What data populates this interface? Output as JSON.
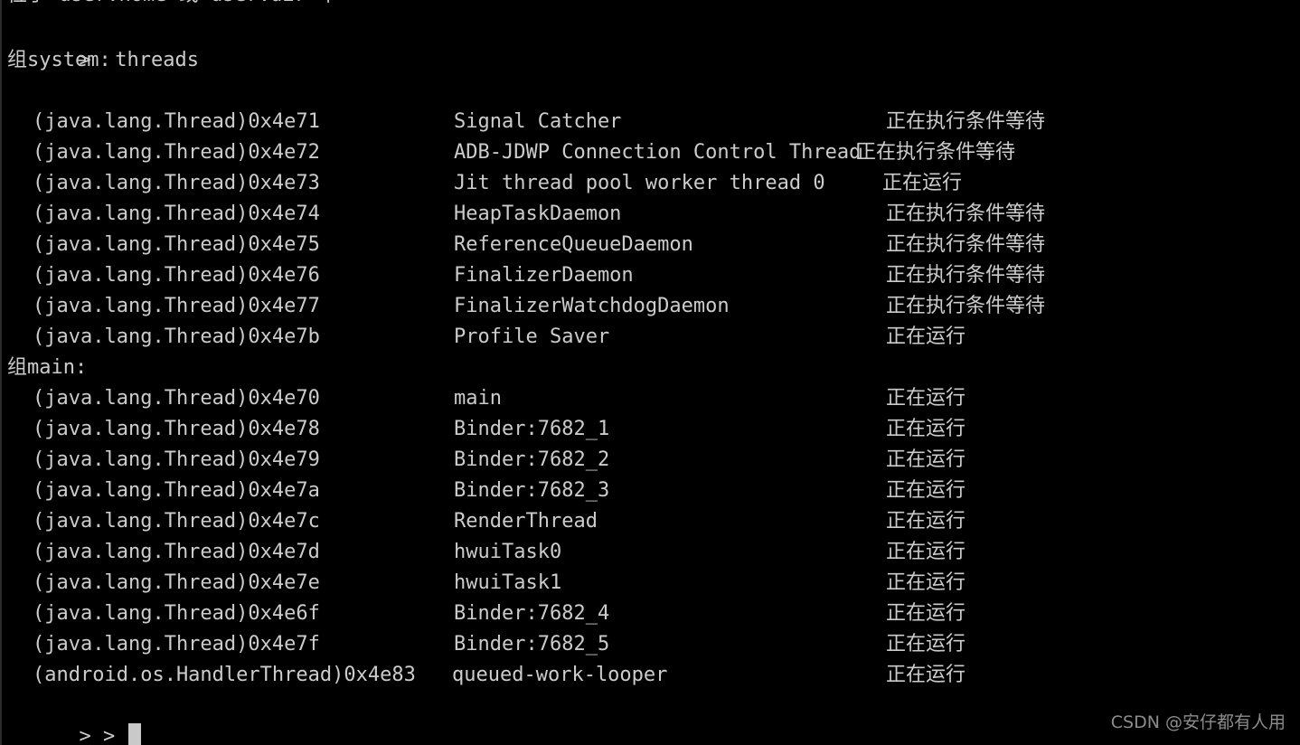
{
  "terminal": {
    "colors": {
      "background": "#000000",
      "foreground": "#cccccc",
      "cursor": "#c9c9c9",
      "watermark": "#8c8c8c",
      "left_border": "#2a2a2a"
    },
    "clipped_top_line": "位于 user.home 或 user.dir 中",
    "command_line": ">  threads",
    "prompt_trailing": "> > ",
    "watermark": "CSDN @安仔都有人用"
  },
  "groups": [
    {
      "header": "组system:",
      "threads": [
        {
          "id": "(java.lang.Thread)0x4e71",
          "name": "Signal Catcher",
          "state": "正在执行条件等待",
          "layout": "normal"
        },
        {
          "id": "(java.lang.Thread)0x4e72",
          "name": "ADB-JDWP Connection Control Thread",
          "state": "正在执行条件等待",
          "layout": "name-overflow"
        },
        {
          "id": "(java.lang.Thread)0x4e73",
          "name": "Jit thread pool worker thread 0",
          "state": "正在运行",
          "layout": "state-early"
        },
        {
          "id": "(java.lang.Thread)0x4e74",
          "name": "HeapTaskDaemon",
          "state": "正在执行条件等待",
          "layout": "normal"
        },
        {
          "id": "(java.lang.Thread)0x4e75",
          "name": "ReferenceQueueDaemon",
          "state": "正在执行条件等待",
          "layout": "normal"
        },
        {
          "id": "(java.lang.Thread)0x4e76",
          "name": "FinalizerDaemon",
          "state": "正在执行条件等待",
          "layout": "normal"
        },
        {
          "id": "(java.lang.Thread)0x4e77",
          "name": "FinalizerWatchdogDaemon",
          "state": "正在执行条件等待",
          "layout": "normal"
        },
        {
          "id": "(java.lang.Thread)0x4e7b",
          "name": "Profile Saver",
          "state": "正在运行",
          "layout": "normal"
        }
      ]
    },
    {
      "header": "组main:",
      "threads": [
        {
          "id": "(java.lang.Thread)0x4e70",
          "name": "main",
          "state": "正在运行",
          "layout": "normal"
        },
        {
          "id": "(java.lang.Thread)0x4e78",
          "name": "Binder:7682_1",
          "state": "正在运行",
          "layout": "normal"
        },
        {
          "id": "(java.lang.Thread)0x4e79",
          "name": "Binder:7682_2",
          "state": "正在运行",
          "layout": "normal"
        },
        {
          "id": "(java.lang.Thread)0x4e7a",
          "name": "Binder:7682_3",
          "state": "正在运行",
          "layout": "normal"
        },
        {
          "id": "(java.lang.Thread)0x4e7c",
          "name": "RenderThread",
          "state": "正在运行",
          "layout": "normal"
        },
        {
          "id": "(java.lang.Thread)0x4e7d",
          "name": "hwuiTask0",
          "state": "正在运行",
          "layout": "normal"
        },
        {
          "id": "(java.lang.Thread)0x4e7e",
          "name": "hwuiTask1",
          "state": "正在运行",
          "layout": "normal"
        },
        {
          "id": "(java.lang.Thread)0x4e6f",
          "name": "Binder:7682_4",
          "state": "正在运行",
          "layout": "normal"
        },
        {
          "id": "(java.lang.Thread)0x4e7f",
          "name": "Binder:7682_5",
          "state": "正在运行",
          "layout": "normal"
        },
        {
          "id": "(android.os.HandlerThread)0x4e83",
          "name": "queued-work-looper",
          "state": "正在运行",
          "layout": "wide-id"
        }
      ]
    }
  ]
}
